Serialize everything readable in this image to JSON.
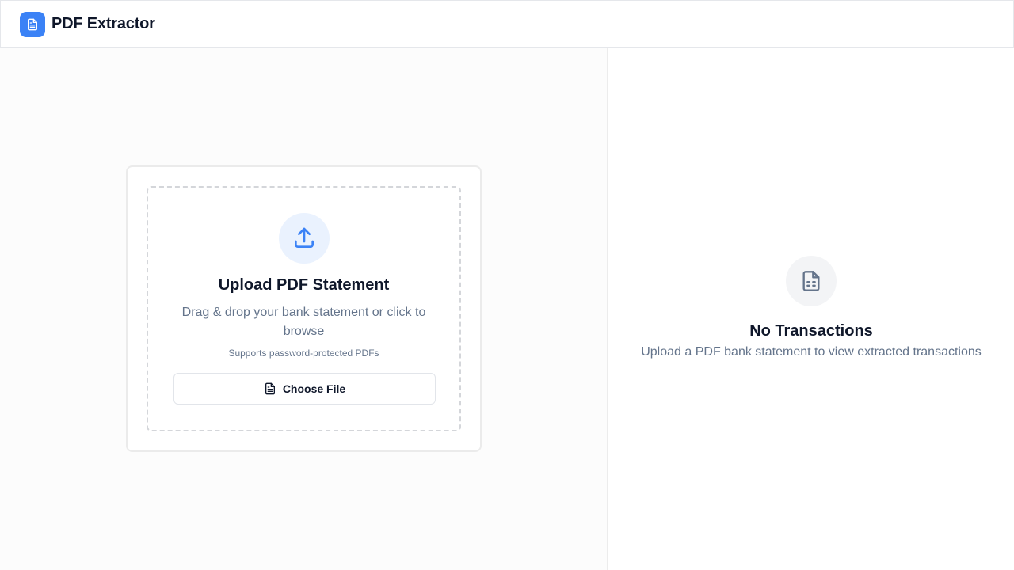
{
  "header": {
    "title": "PDF Extractor",
    "logo_icon": "file-text-icon",
    "accent_color": "#3b82f6"
  },
  "upload": {
    "icon": "upload-icon",
    "title": "Upload PDF Statement",
    "description": "Drag & drop your bank statement or click to browse",
    "note": "Supports password-protected PDFs",
    "button_label": "Choose File",
    "button_icon": "file-icon"
  },
  "empty_state": {
    "icon": "file-spreadsheet-icon",
    "title": "No Transactions",
    "description": "Upload a PDF bank statement to view extracted transactions"
  }
}
